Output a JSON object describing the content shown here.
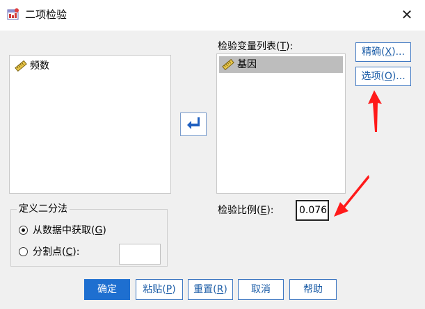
{
  "window": {
    "title": "二项检验",
    "close_glyph": "✕"
  },
  "source_list": {
    "items": [
      {
        "label": "频数"
      }
    ]
  },
  "test_variables": {
    "label_main": "检验变量列表(",
    "label_key": "T",
    "label_end": "):",
    "items": [
      {
        "label": "基因",
        "selected": true
      }
    ]
  },
  "side_buttons": {
    "exact": {
      "main": "精确(",
      "key": "X",
      "end": ")..."
    },
    "options": {
      "main": "选项(",
      "key": "O",
      "end": ")..."
    }
  },
  "dichotomy": {
    "legend": "定义二分法",
    "from_data": {
      "main": "从数据中获取(",
      "key": "G",
      "end": ")",
      "checked": true
    },
    "cut_point": {
      "main": "分割点(",
      "key": "C",
      "end": "):",
      "checked": false,
      "value": ""
    }
  },
  "test_proportion": {
    "label_main": "检验比例(",
    "label_key": "E",
    "label_end": "):",
    "value": "0.076"
  },
  "bottom_buttons": {
    "ok": "确定",
    "paste": {
      "main": "粘贴(",
      "key": "P",
      "end": ")"
    },
    "reset": {
      "main": "重置(",
      "key": "R",
      "end": ")"
    },
    "cancel": "取消",
    "help": "帮助"
  },
  "colors": {
    "accent": "#1e6fd0",
    "button_text": "#1f5fa8",
    "annotation_red": "#ff1a1a",
    "selected_row": "#bdbdbd"
  }
}
